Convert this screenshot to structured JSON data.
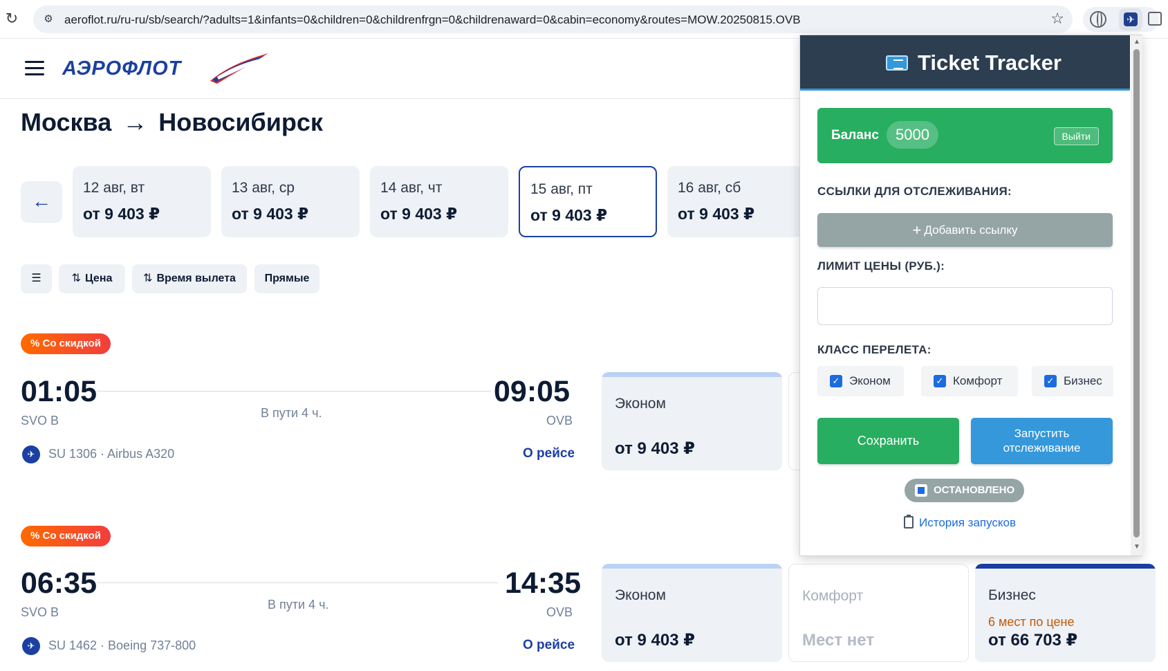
{
  "browser": {
    "url": "aeroflot.ru/ru-ru/sb/search/?adults=1&infants=0&children=0&childrenfrgn=0&childrenaward=0&cabin=economy&routes=MOW.20250815.OVB"
  },
  "site": {
    "logo_text": "АЭРОФЛОТ",
    "route_from": "Москва",
    "route_arrow": "→",
    "route_to": "Новосибирск"
  },
  "dates": [
    {
      "date": "12 авг, вт",
      "price": "от 9 403 ₽"
    },
    {
      "date": "13 авг, ср",
      "price": "от 9 403 ₽"
    },
    {
      "date": "14 авг, чт",
      "price": "от 9 403 ₽"
    },
    {
      "date": "15 авг, пт",
      "price": "от 9 403 ₽"
    },
    {
      "date": "16 авг, сб",
      "price": "от 9 403 ₽"
    }
  ],
  "filters": {
    "price": "Цена",
    "departure_time": "Время вылета",
    "direct": "Прямые"
  },
  "flights": [
    {
      "badge": "% Со скидкой",
      "dep_time": "01:05",
      "dep_airport": "SVO B",
      "duration": "В пути 4 ч.",
      "arr_time": "09:05",
      "arr_airport": "OVB",
      "flight_info": "SU 1306 · Airbus A320",
      "about": "О рейсе",
      "fares": [
        {
          "class": "Эконом",
          "price": "от 9 403 ₽"
        }
      ]
    },
    {
      "badge": "% Со скидкой",
      "dep_time": "06:35",
      "dep_airport": "SVO B",
      "duration": "В пути 4 ч.",
      "arr_time": "14:35",
      "arr_airport": "OVB",
      "flight_info": "SU 1462 · Boeing 737-800",
      "about": "О рейсе",
      "fares": [
        {
          "class": "Эконом",
          "price": "от 9 403 ₽"
        },
        {
          "class": "Комфорт",
          "price": "Мест нет"
        },
        {
          "class": "Бизнес",
          "note": "6 мест по цене",
          "price": "от 66 703 ₽"
        }
      ]
    }
  ],
  "popup": {
    "title": "Ticket Tracker",
    "balance_label": "Баланс",
    "balance_value": "5000",
    "logout": "Выйти",
    "links_label": "ССЫЛКИ ДЛЯ ОТСЛЕЖИВАНИЯ:",
    "add_link": "Добавить ссылку",
    "price_limit_label": "ЛИМИТ ЦЕНЫ (РУБ.):",
    "price_limit_value": "",
    "class_label": "КЛАСС ПЕРЕЛЕТА:",
    "classes": [
      {
        "label": "Эконом",
        "checked": true
      },
      {
        "label": "Комфорт",
        "checked": true
      },
      {
        "label": "Бизнес",
        "checked": true
      }
    ],
    "save": "Сохранить",
    "start_line1": "Запустить",
    "start_line2": "отслеживание",
    "status": "ОСТАНОВЛЕНО",
    "history": "История запусков"
  }
}
